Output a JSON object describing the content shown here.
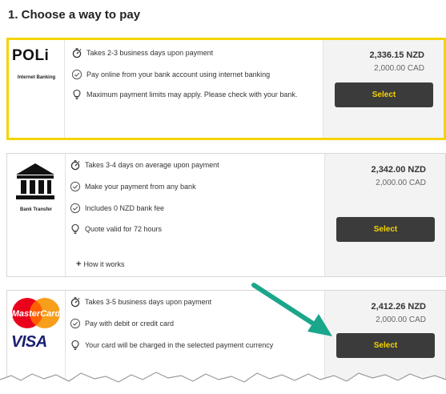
{
  "page_title": "1. Choose a way to pay",
  "colors": {
    "accent_yellow": "#f4d400",
    "button_bg": "#3b3b3b",
    "arrow_green": "#1aa68a"
  },
  "options": [
    {
      "id": "poli",
      "logo_text": "POLi",
      "logo_caption": "Internet Banking",
      "features": [
        {
          "icon": "stopwatch-icon",
          "text": "Takes 2-3 business days upon payment"
        },
        {
          "icon": "check-circle-icon",
          "text": "Pay online from your bank account using internet banking"
        },
        {
          "icon": "lightbulb-icon",
          "text": "Maximum payment limits may apply. Please check with your bank."
        }
      ],
      "price": "2,336.15 NZD",
      "sub_price": "2,000.00 CAD",
      "button_label": "Select"
    },
    {
      "id": "bank-transfer",
      "logo_caption": "Bank Transfer",
      "features": [
        {
          "icon": "stopwatch-icon",
          "text": "Takes 3-4 days on average upon payment"
        },
        {
          "icon": "check-circle-icon",
          "text": "Make your payment from any bank"
        },
        {
          "icon": "check-circle-icon",
          "text": "Includes 0 NZD bank fee"
        },
        {
          "icon": "lightbulb-icon",
          "text": "Quote valid for 72 hours"
        }
      ],
      "link_label": "How it works",
      "price": "2,342.00 NZD",
      "sub_price": "2,000.00 CAD",
      "button_label": "Select"
    },
    {
      "id": "card",
      "logo_mastercard": "MasterCard",
      "logo_visa": "VISA",
      "features": [
        {
          "icon": "stopwatch-icon",
          "text": "Takes 3-5 business days upon payment"
        },
        {
          "icon": "check-circle-icon",
          "text": "Pay with debit or credit card"
        },
        {
          "icon": "lightbulb-icon",
          "text": "Your card will be charged in the selected payment currency"
        }
      ],
      "price": "2,412.26 NZD",
      "sub_price": "2,000.00 CAD",
      "button_label": "Select"
    }
  ]
}
